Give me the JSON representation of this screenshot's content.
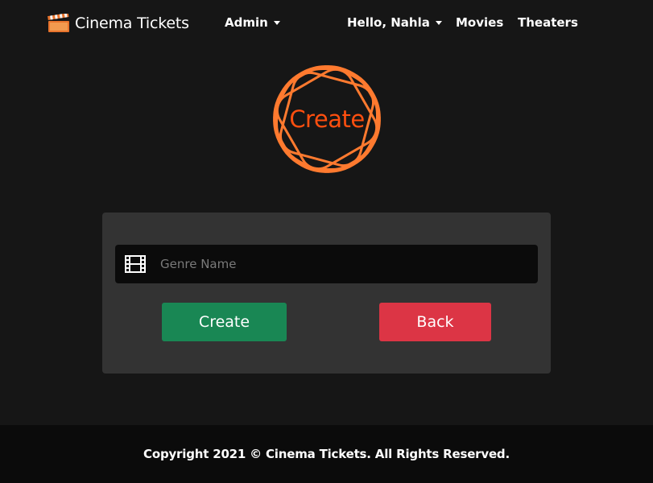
{
  "brand": {
    "title": "Cinema Tickets",
    "icon": "clapperboard-icon"
  },
  "nav": {
    "admin_label": "Admin",
    "user_label": "Hello, Nahla",
    "movies_label": "Movies",
    "theaters_label": "Theaters"
  },
  "hero": {
    "title": "Create",
    "icon": "rosette-icon"
  },
  "form": {
    "genre_placeholder": "Genre Name",
    "genre_value": "",
    "input_icon": "film-icon",
    "create_label": "Create",
    "back_label": "Back"
  },
  "footer": {
    "copyright": "Copyright 2021 © Cinema Tickets. All Rights Reserved."
  },
  "colors": {
    "background": "#161616",
    "card": "#333333",
    "input": "#0b0b0b",
    "accent": "#ff7a2f",
    "create_button": "#198754",
    "back_button": "#dc3545"
  }
}
